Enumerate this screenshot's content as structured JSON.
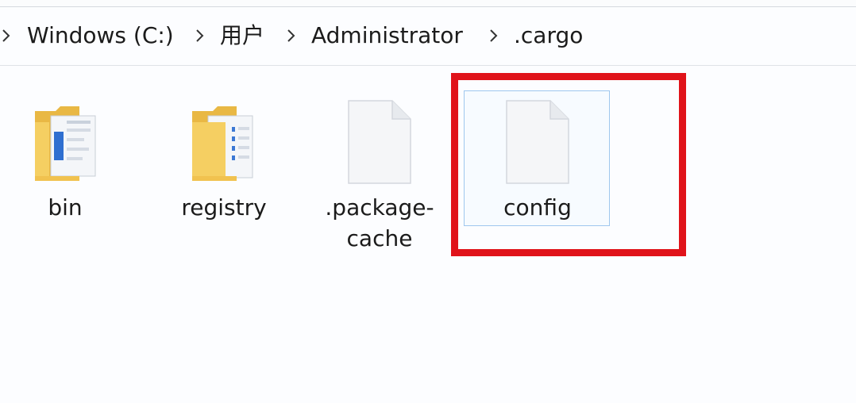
{
  "breadcrumb": {
    "parts": [
      "Windows (C:)",
      "用户",
      "Administrator",
      ".cargo"
    ]
  },
  "items": [
    {
      "label": "bin",
      "type": "folder"
    },
    {
      "label": "registry",
      "type": "folder"
    },
    {
      "label_line1": ".package-",
      "label_line2": "cache",
      "type": "file"
    },
    {
      "label": "config",
      "type": "file",
      "selected": true
    }
  ],
  "colors": {
    "highlight_box": "#e0131a",
    "selection_border": "#9fc7ee",
    "folder": "#f3c85a"
  }
}
